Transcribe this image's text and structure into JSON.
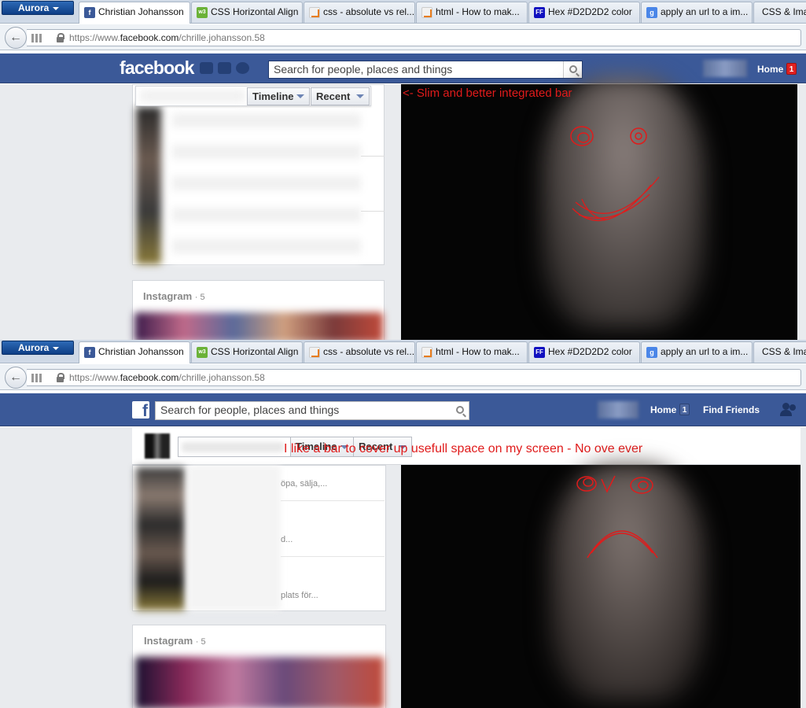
{
  "browser": {
    "menu_label": "Aurora",
    "tabs": [
      {
        "title": "Christian Johansson",
        "favicon": "facebook-favicon",
        "active": true
      },
      {
        "title": "CSS Horizontal Align",
        "favicon": "w3schools-favicon"
      },
      {
        "title": "css - absolute vs rel...",
        "favicon": "stackoverflow-favicon"
      },
      {
        "title": "html - How to mak...",
        "favicon": "stackoverflow-favicon"
      },
      {
        "title": "Hex #D2D2D2 color",
        "favicon": "ff-favicon"
      },
      {
        "title": "apply an url to a im...",
        "favicon": "google-favicon"
      },
      {
        "title": "CSS & Ima",
        "favicon": "none"
      }
    ],
    "url_prefix": "https://www.",
    "url_domain": "facebook.com",
    "url_path": "/chrille.johansson.58"
  },
  "facebook": {
    "logo": "facebook",
    "search_placeholder": "Search for people, places and things",
    "home_label": "Home",
    "home_badge": "1",
    "find_friends": "Find Friends"
  },
  "timeline_bar": {
    "timeline_label": "Timeline",
    "recent_label": "Recent"
  },
  "instagram": {
    "label": "Instagram",
    "count": "· 5"
  },
  "annotations": {
    "top": "<- Slim and better integrated bar",
    "bottom": "I like a bar to cover up usefull  space on my screen - No ove ever"
  },
  "feed_snippets": [
    "öpa, sälja,...",
    "d...",
    "plats för..."
  ],
  "colors": {
    "facebook_blue": "#3b5998",
    "annotation_red": "#e01b1b",
    "page_bg": "#e9ebee"
  }
}
